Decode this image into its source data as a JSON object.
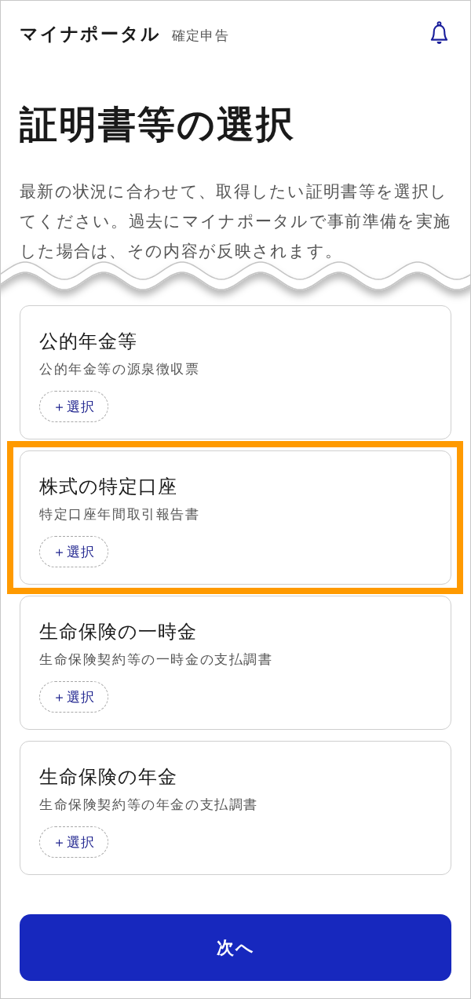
{
  "header": {
    "app_name": "マイナポータル",
    "section": "確定申告"
  },
  "page_title": "証明書等の選択",
  "description": "最新の状況に合わせて、取得したい証明書等を選択してください。過去にマイナポータルで事前準備を実施した場合は、その内容が反映されます。",
  "documents": [
    {
      "title": "公的年金等",
      "subtitle": "公的年金等の源泉徴収票",
      "button": "＋選択",
      "highlighted": false
    },
    {
      "title": "株式の特定口座",
      "subtitle": "特定口座年間取引報告書",
      "button": "＋選択",
      "highlighted": true
    },
    {
      "title": "生命保険の一時金",
      "subtitle": "生命保険契約等の一時金の支払調書",
      "button": "＋選択",
      "highlighted": false
    },
    {
      "title": "生命保険の年金",
      "subtitle": "生命保険契約等の年金の支払調書",
      "button": "＋選択",
      "highlighted": false
    }
  ],
  "next_button": "次へ"
}
